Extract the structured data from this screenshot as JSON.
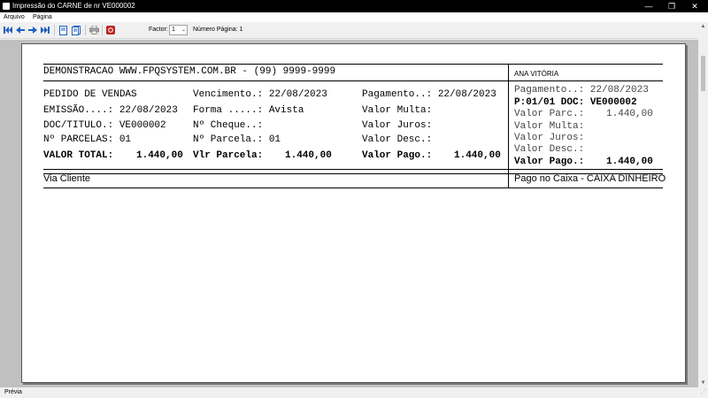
{
  "window": {
    "title": "Impressão do CARNE de nr VE000002",
    "minimize_glyph": "—",
    "maximize_glyph": "❐",
    "close_glyph": "✕"
  },
  "menu": {
    "items": [
      {
        "label": "Arquivo"
      },
      {
        "label": "Página"
      }
    ]
  },
  "toolbar": {
    "buttons": [
      {
        "icon": "first-page-icon"
      },
      {
        "icon": "prev-page-icon"
      },
      {
        "icon": "next-page-icon"
      },
      {
        "icon": "last-page-icon"
      },
      {
        "icon": "single-page-icon"
      },
      {
        "icon": "multi-page-icon"
      },
      {
        "icon": "print-icon"
      },
      {
        "icon": "close-preview-icon"
      }
    ],
    "factor_label": "Factor:",
    "factor_value": "1",
    "page_number_label": "Número Página: 1"
  },
  "report": {
    "header": "DEMONSTRACAO WWW.FPQSYSTEM.COM.BR - (99) 9999-9999",
    "customer": "ANA VITÓRIA",
    "left": {
      "rows": [
        [
          "PEDIDO DE VENDAS",
          "Vencimento.: 22/08/2023",
          "Pagamento..: 22/08/2023"
        ],
        [
          "EMISSÃO....: 22/08/2023",
          "Forma .....: Avista",
          "Valor Multa:"
        ],
        [
          "DOC/TITULO.: VE000002",
          "Nº Cheque..:",
          "Valor Juros:"
        ],
        [
          "Nº PARCELAS: 01",
          "Nº Parcela.: 01",
          "Valor Desc.:"
        ]
      ],
      "totals": {
        "valor_total_label": "VALOR TOTAL:",
        "valor_total": "1.440,00",
        "vlr_parcela_label": "Vlr Parcela:",
        "vlr_parcela": "1.440,00",
        "valor_pago_label": "Valor Pago.:",
        "valor_pago": "1.440,00"
      },
      "footer": "Via Cliente"
    },
    "right": {
      "pagamento": "Pagamento..: 22/08/2023",
      "parcela_doc": "P:01/01 DOC: VE000002",
      "valor_parc_label": "Valor Parc.:",
      "valor_parc": "1.440,00",
      "valor_multa": "Valor Multa:",
      "valor_juros": "Valor Juros:",
      "valor_desc": "Valor Desc.:",
      "valor_pago_label": "Valor Pago.:",
      "valor_pago": "1.440,00",
      "footer": "Pago no Caixa - CAIXA DINHEIRO"
    }
  },
  "status": {
    "text": "Prévia"
  },
  "colors": {
    "titlebar": "#000000",
    "accent_blue": "#2060c0",
    "close_red": "#d02020"
  }
}
